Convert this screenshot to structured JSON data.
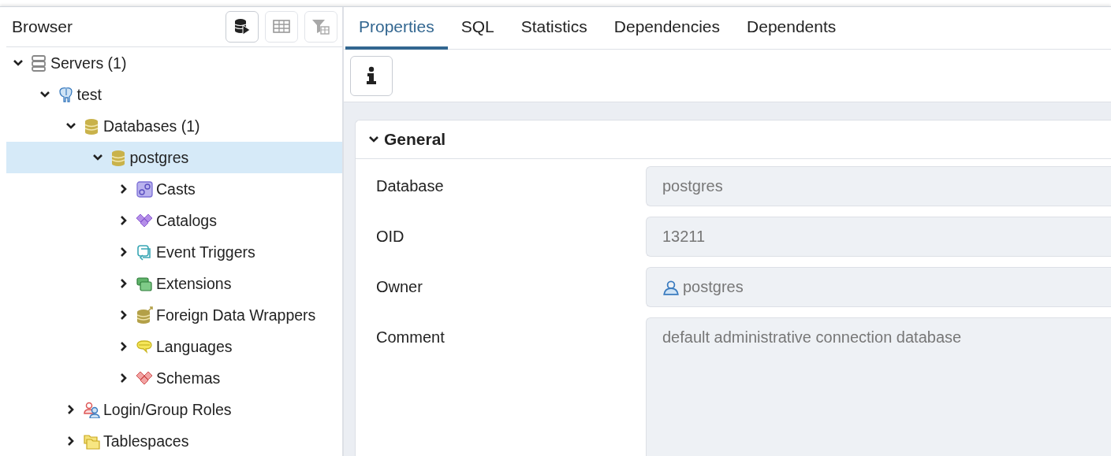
{
  "browser": {
    "title": "Browser",
    "toolbar": [
      {
        "kind": "query",
        "disabled": false
      },
      {
        "kind": "table",
        "disabled": true
      },
      {
        "kind": "filter",
        "disabled": true
      }
    ],
    "tree": [
      {
        "label": "Servers (1)",
        "kind": "servers",
        "expanded": true,
        "selected": false,
        "children": [
          {
            "label": "test",
            "kind": "server",
            "expanded": true,
            "selected": false,
            "children": [
              {
                "label": "Databases (1)",
                "kind": "databases",
                "expanded": true,
                "selected": false,
                "children": [
                  {
                    "label": "postgres",
                    "kind": "database",
                    "expanded": true,
                    "selected": true,
                    "children": [
                      {
                        "label": "Casts",
                        "kind": "casts",
                        "expanded": false,
                        "selected": false
                      },
                      {
                        "label": "Catalogs",
                        "kind": "catalogs",
                        "expanded": false,
                        "selected": false
                      },
                      {
                        "label": "Event Triggers",
                        "kind": "triggers",
                        "expanded": false,
                        "selected": false
                      },
                      {
                        "label": "Extensions",
                        "kind": "extensions",
                        "expanded": false,
                        "selected": false
                      },
                      {
                        "label": "Foreign Data Wrappers",
                        "kind": "fdw",
                        "expanded": false,
                        "selected": false
                      },
                      {
                        "label": "Languages",
                        "kind": "languages",
                        "expanded": false,
                        "selected": false
                      },
                      {
                        "label": "Schemas",
                        "kind": "schemas",
                        "expanded": false,
                        "selected": false
                      }
                    ]
                  }
                ]
              },
              {
                "label": "Login/Group Roles",
                "kind": "roles",
                "expanded": false,
                "selected": false
              },
              {
                "label": "Tablespaces",
                "kind": "tablespaces",
                "expanded": false,
                "selected": false
              }
            ]
          }
        ]
      }
    ]
  },
  "tabs": [
    {
      "label": "Properties",
      "selected": true
    },
    {
      "label": "SQL",
      "selected": false
    },
    {
      "label": "Statistics",
      "selected": false
    },
    {
      "label": "Dependencies",
      "selected": false
    },
    {
      "label": "Dependents",
      "selected": false
    }
  ],
  "section": {
    "title": "General",
    "expanded": true,
    "fields": [
      {
        "label": "Database",
        "value": "postgres",
        "kind": "text"
      },
      {
        "label": "OID",
        "value": "13211",
        "kind": "text"
      },
      {
        "label": "Owner",
        "value": "postgres",
        "kind": "user"
      },
      {
        "label": "Comment",
        "value": "default administrative connection database",
        "kind": "textarea"
      }
    ]
  }
}
